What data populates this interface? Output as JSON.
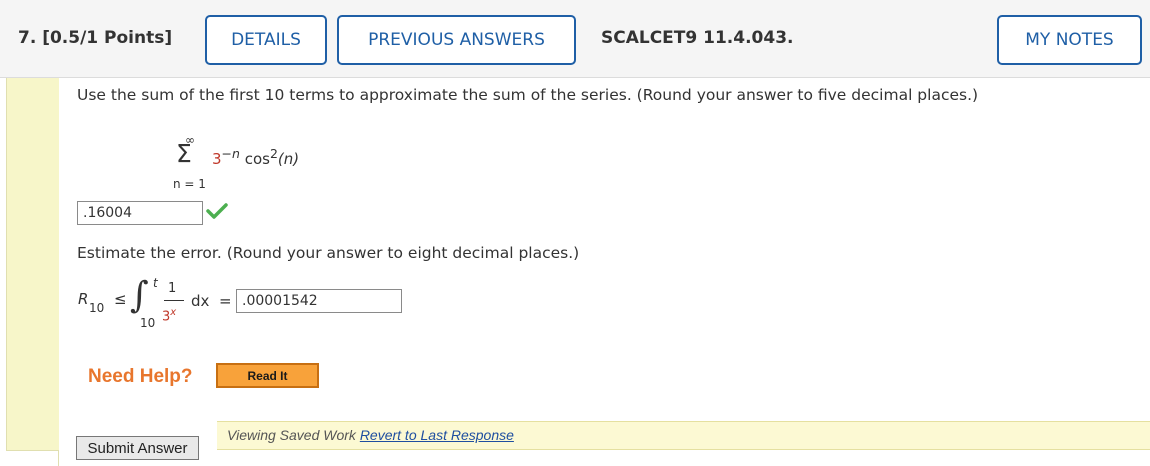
{
  "header": {
    "question_number": "7. [0.5/1 Points]",
    "details_label": "DETAILS",
    "previous_answers_label": "PREVIOUS ANSWERS",
    "problem_code": "SCALCET9 11.4.043.",
    "my_notes_label": "MY NOTES"
  },
  "question": {
    "prompt": "Use the sum of the first 10 terms to approximate the sum of the series. (Round your answer to five decimal places.)",
    "series": {
      "sigma": "Σ",
      "upper": "∞",
      "lower": "n = 1",
      "base": "3",
      "exponent": "−n",
      "func": " cos",
      "func_exp": "2",
      "arg": "(n)"
    },
    "answer1_value": ".16004",
    "answer1_status_icon": "checkmark-icon",
    "prompt2": "Estimate the error. (Round your answer to eight decimal places.)",
    "integral": {
      "r": "R",
      "r_sub": "10",
      "le": "≤",
      "upper": "t",
      "lower": "10",
      "numerator": "1",
      "denominator_base": "3",
      "denominator_exp": "x",
      "dx": "dx",
      "equals": "="
    },
    "answer2_value": ".00001542"
  },
  "help": {
    "need_help": "Need Help?",
    "read_it": "Read It"
  },
  "footer": {
    "viewing_saved": "Viewing Saved Work",
    "revert_link": "Revert to Last Response",
    "submit_label": "Submit Answer"
  },
  "colors": {
    "accent_blue": "#1f5fa6",
    "red_term": "#c0392b",
    "orange_help": "#e8762d",
    "check_green": "#4caf50"
  }
}
